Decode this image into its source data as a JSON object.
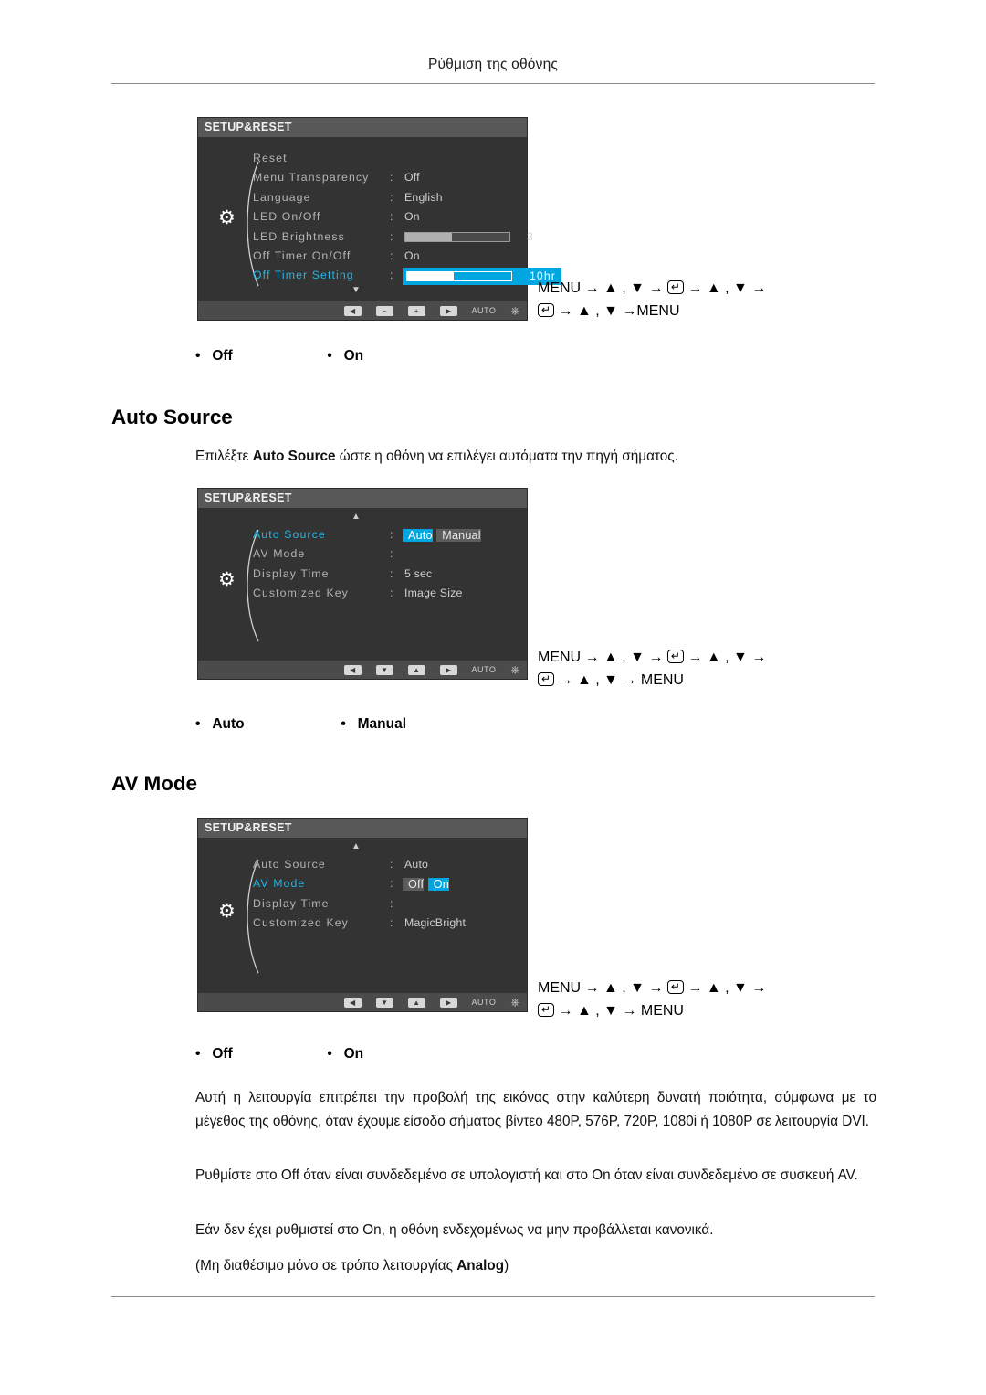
{
  "header": {
    "title": "Ρύθμιση της οθόνης"
  },
  "sections": [
    {
      "id": "off-timer-setting",
      "osd": {
        "title": "SETUP&RESET",
        "gear_icon": "gear-icon",
        "rows": [
          {
            "name": "Reset",
            "colon": "",
            "value": ""
          },
          {
            "name": "Menu Transparency",
            "colon": ":",
            "value": "Off"
          },
          {
            "name": "Language",
            "colon": ":",
            "value": "English"
          },
          {
            "name": "LED On/Off",
            "colon": ":",
            "value": "On"
          },
          {
            "name": "LED Brightness",
            "colon": ":",
            "value": "",
            "slider_percent": 45,
            "slider_number": "3"
          },
          {
            "name": "Off Timer On/Off",
            "colon": ":",
            "value": "On"
          },
          {
            "name": "Off Timer Setting",
            "colon": ":",
            "value": "",
            "highlighted": true,
            "slider_percent": 45,
            "slider_number": "10hr"
          }
        ],
        "caret_down": "▼",
        "toolbar": {
          "buttons": [
            "◀",
            "−",
            "+",
            "▶"
          ],
          "auto_label": "AUTO",
          "power_icon": "power-icon"
        }
      },
      "nav_line1": "MENU → ▲ , ▼ →",
      "nav_line1_tail": "→ ▲ , ▼ →",
      "nav_line2_tail": "→ ▲ , ▼ →MENU",
      "bullets": [
        "Off",
        "On"
      ]
    },
    {
      "id": "auto-source",
      "heading": "Auto Source",
      "intro_before": "Επιλέξτε ",
      "intro_bold": "Auto Source",
      "intro_after": " ώστε η οθόνη να επιλέγει αυτόματα την πηγή σήματος.",
      "osd": {
        "title": "SETUP&RESET",
        "gear_icon": "gear-icon",
        "caret_up": "▲",
        "rows": [
          {
            "name": "Auto Source",
            "colon": ":",
            "value": "",
            "highlighted": true,
            "options": [
              "Auto",
              "Manual"
            ],
            "selected": "Auto"
          },
          {
            "name": "AV Mode",
            "colon": ":",
            "value": ""
          },
          {
            "name": "Display Time",
            "colon": ":",
            "value": "5 sec"
          },
          {
            "name": "Customized Key",
            "colon": ":",
            "value": "Image Size"
          }
        ],
        "toolbar": {
          "buttons": [
            "◀",
            "▼",
            "▲",
            "▶"
          ],
          "auto_label": "AUTO",
          "power_icon": "power-icon"
        }
      },
      "nav_line1": "MENU → ▲ , ▼ →",
      "nav_line1_tail": "→ ▲ , ▼ →",
      "nav_line2_tail": "→ ▲ , ▼ → MENU",
      "bullets": [
        "Auto",
        "Manual"
      ]
    },
    {
      "id": "av-mode",
      "heading": "AV Mode",
      "osd": {
        "title": "SETUP&RESET",
        "gear_icon": "gear-icon",
        "caret_up": "▲",
        "rows": [
          {
            "name": "Auto Source",
            "colon": ":",
            "value": "Auto"
          },
          {
            "name": "AV Mode",
            "colon": ":",
            "value": "",
            "highlighted": true,
            "options": [
              "Off",
              "On"
            ],
            "selected": "On"
          },
          {
            "name": "Display Time",
            "colon": ":",
            "value": ""
          },
          {
            "name": "Customized Key",
            "colon": ":",
            "value": "MagicBright"
          }
        ],
        "toolbar": {
          "buttons": [
            "◀",
            "▼",
            "▲",
            "▶"
          ],
          "auto_label": "AUTO",
          "power_icon": "power-icon"
        }
      },
      "nav_line1": "MENU → ▲ , ▼ →",
      "nav_line1_tail": "→ ▲ , ▼ →",
      "nav_line2_tail": "→ ▲ , ▼ → MENU",
      "bullets": [
        "Off",
        "On"
      ],
      "paragraphs": [
        "Αυτή η λειτουργία επιτρέπει την προβολή της εικόνας στην καλύτερη δυνατή ποιότητα, σύμφωνα με το μέγεθος της οθόνης, όταν έχουμε είσοδο σήματος βίντεο 480P, 576P, 720P, 1080i ή 1080P σε λειτουργία DVI.",
        "Ρυθμίστε στο Off όταν είναι συνδεδεμένο σε υπολογιστή και στο On όταν είναι συνδεδεμένο σε συσκευή AV.",
        "Εάν δεν έχει ρυθμιστεί στο On, η οθόνη ενδεχομένως να μην προβάλλεται κανονικά."
      ],
      "note_before": "(Μη διαθέσιμο μόνο σε τρόπο λειτουργίας ",
      "note_bold": "Analog",
      "note_after": ")"
    }
  ]
}
